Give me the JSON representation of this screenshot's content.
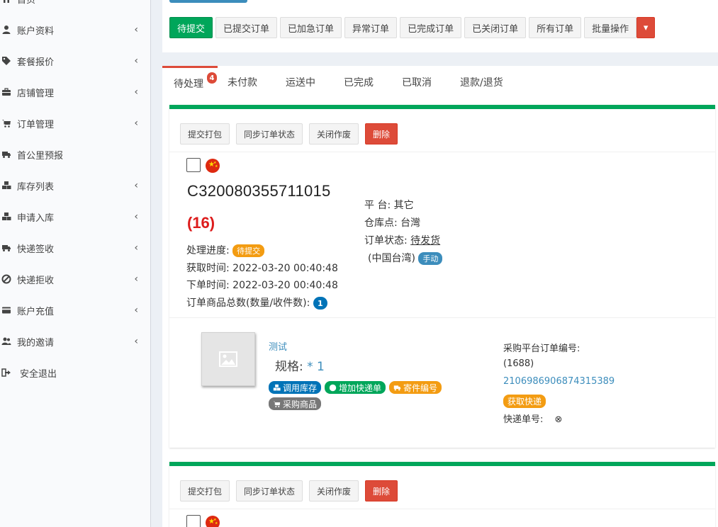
{
  "sidebar": {
    "items": [
      {
        "icon": "home-icon",
        "label": "首页",
        "chevron": false
      },
      {
        "icon": "user-icon",
        "label": "账户资料",
        "chevron": true
      },
      {
        "icon": "tags-icon",
        "label": "套餐报价",
        "chevron": true
      },
      {
        "icon": "briefcase-icon",
        "label": "店铺管理",
        "chevron": true
      },
      {
        "icon": "cart-icon",
        "label": "订单管理",
        "chevron": true
      },
      {
        "icon": "truck-icon",
        "label": "首公里预报",
        "chevron": false
      },
      {
        "icon": "cubes-icon",
        "label": "库存列表",
        "chevron": true
      },
      {
        "icon": "cubes-icon",
        "label": "申请入库",
        "chevron": true
      },
      {
        "icon": "truck-icon",
        "label": "快递签收",
        "chevron": true
      },
      {
        "icon": "ban-icon",
        "label": "快递拒收",
        "chevron": true
      },
      {
        "icon": "credit-card-icon",
        "label": "账户充值",
        "chevron": true
      },
      {
        "icon": "users-icon",
        "label": "我的邀请",
        "chevron": true
      },
      {
        "icon": "sign-out-icon",
        "label": "安全退出",
        "chevron": false
      }
    ],
    "chevron_glyph": "‹"
  },
  "filters": [
    "待提交",
    "已提交订单",
    "已加急订单",
    "异常订单",
    "已完成订单",
    "已关闭订单",
    "所有订单",
    "批量操作"
  ],
  "filter_caret": "▾",
  "tabs": [
    {
      "label": "待处理",
      "badge": "4"
    },
    {
      "label": "未付款"
    },
    {
      "label": "运送中"
    },
    {
      "label": "已完成"
    },
    {
      "label": "已取消"
    },
    {
      "label": "退款/退货"
    }
  ],
  "actions": {
    "pack": "提交打包",
    "sync": "同步订单状态",
    "close": "关闭作废",
    "delete": "删除"
  },
  "order": {
    "number": "C320080355711015",
    "count": "(16)",
    "progress_label": "处理进度:",
    "progress_value": "待提交",
    "fetch_time_label": "获取时间:",
    "fetch_time": "2022-03-20 00:40:48",
    "order_time_label": "下单时间:",
    "order_time": "2022-03-20 00:40:48",
    "total_label": "订单商品总数(数量/收件数):",
    "total_value": "1",
    "platform_label": "平 台:",
    "platform": "其它",
    "warehouse_label": "仓库点:",
    "warehouse": "台灣",
    "status_label": "订单状态:",
    "status": "待发货",
    "region": "(中国台湾)",
    "manual_badge": "手动"
  },
  "product": {
    "name": "测试",
    "spec_label": "规格:",
    "spec_value": "* 1",
    "tags": [
      {
        "icon": "cubes-icon",
        "label": "调用库存",
        "color": "#0073b7"
      },
      {
        "icon": "plus-circle-icon",
        "label": "增加快递单",
        "color": "#00a65a"
      },
      {
        "icon": "truck-icon",
        "label": "寄件编号",
        "color": "#f39c12"
      },
      {
        "icon": "cart-icon",
        "label": "采购商品",
        "color": "#777777"
      }
    ],
    "purchase_no_label": "采购平台订单编号:",
    "purchase_platform": "(1688)",
    "purchase_no": "2106986906874315389",
    "fetch_express": "获取快递",
    "express_no_label": "快递单号:",
    "express_status_glyph": "⊗"
  },
  "colors": {
    "green": "#00a65a",
    "red": "#dd4b39",
    "blue": "#3c8dbc",
    "orange": "#f39c12"
  }
}
